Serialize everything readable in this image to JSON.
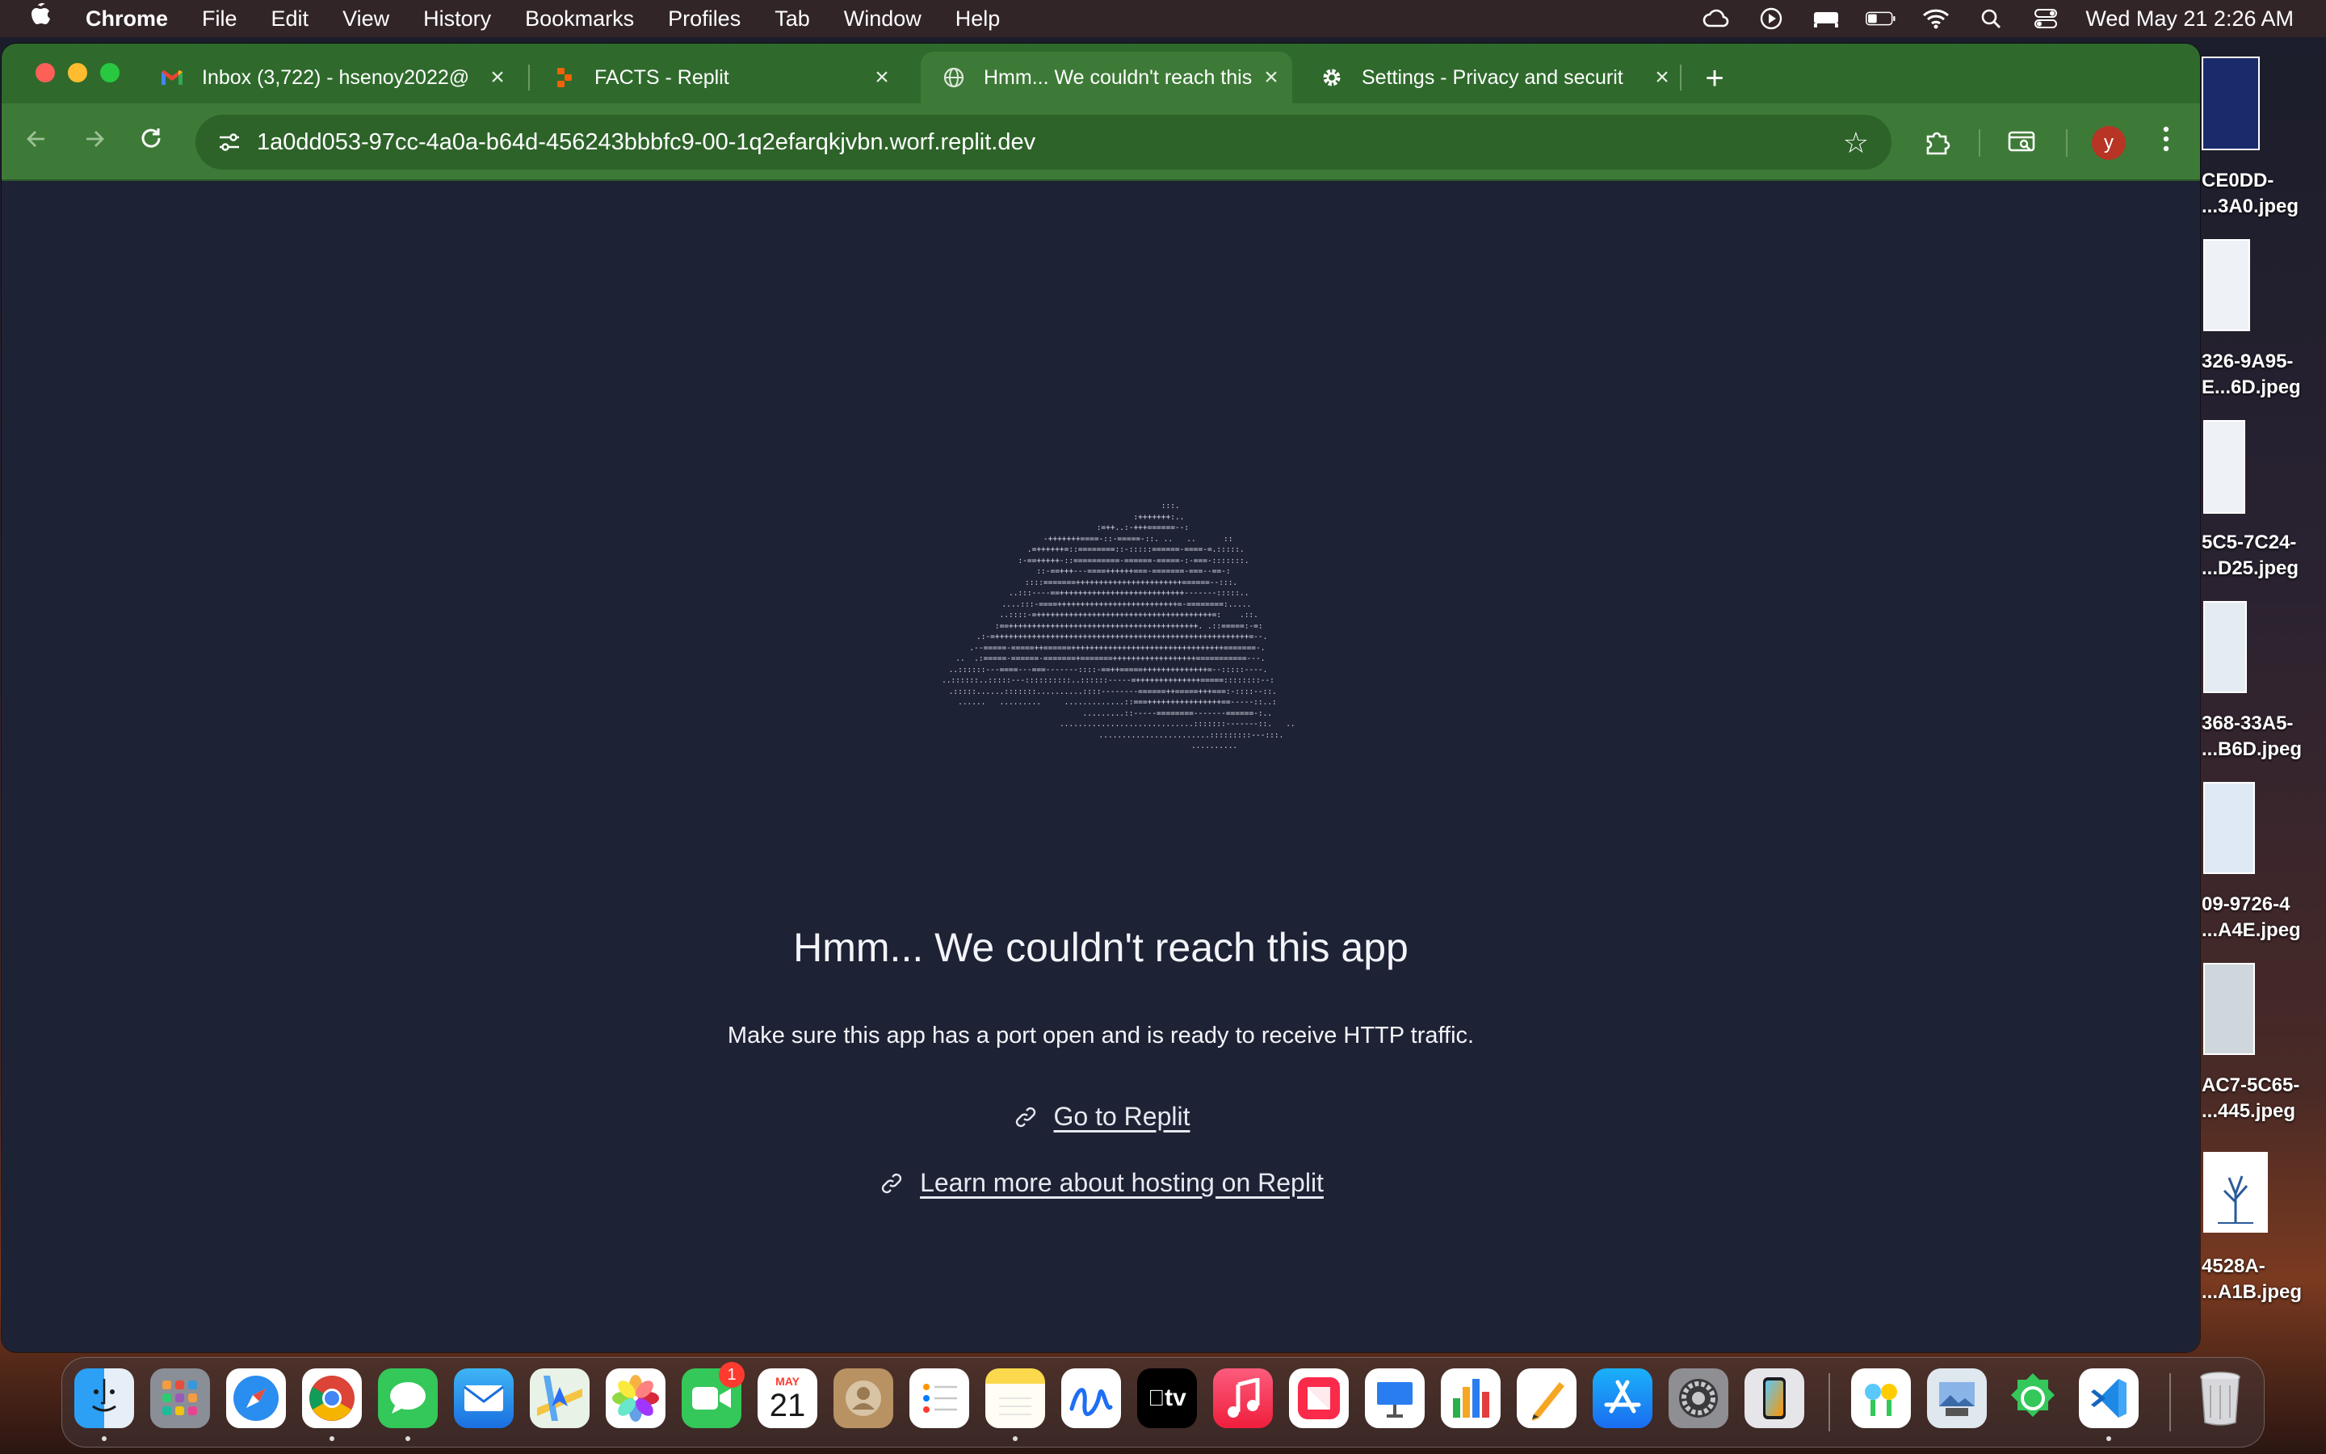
{
  "menubar": {
    "app_name": "Chrome",
    "items": [
      "File",
      "Edit",
      "View",
      "History",
      "Bookmarks",
      "Profiles",
      "Tab",
      "Window",
      "Help"
    ],
    "clock": "Wed May 21  2:26 AM"
  },
  "tabs": [
    {
      "title": "Inbox (3,722) - hsenoy2022@",
      "icon": "gmail-icon",
      "active": false
    },
    {
      "title": "FACTS - Replit",
      "icon": "replit-icon",
      "active": false
    },
    {
      "title": "Hmm... We couldn't reach this",
      "icon": "globe-icon",
      "active": true
    },
    {
      "title": "Settings - Privacy and securit",
      "icon": "gear-icon",
      "active": false
    }
  ],
  "address_bar": {
    "url": "1a0dd053-97cc-4a0a-b64d-456243bbbfc9-00-1q2efarqkjvbn.worf.replit.dev"
  },
  "profile_initial": "y",
  "page": {
    "title": "Hmm... We couldn't reach this app",
    "subtitle": "Make sure this app has a port open and is ready to receive HTTP traffic.",
    "link_replit": "Go to Replit",
    "link_hosting": "Learn more about hosting on Replit"
  },
  "desktop_files": [
    {
      "label_line1": "CE0DD-",
      "label_line2": "...3A0.jpeg"
    },
    {
      "label_line1": "326-9A95-",
      "label_line2": "E...6D.jpeg"
    },
    {
      "label_line1": "5C5-7C24-",
      "label_line2": "...D25.jpeg"
    },
    {
      "label_line1": "368-33A5-",
      "label_line2": "...B6D.jpeg"
    },
    {
      "label_line1": "09-9726-4",
      "label_line2": "...A4E.jpeg"
    },
    {
      "label_line1": "AC7-5C65-",
      "label_line2": "...445.jpeg"
    },
    {
      "label_line1": "4528A-",
      "label_line2": "...A1B.jpeg"
    }
  ],
  "dock": {
    "calendar_month": "MAY",
    "calendar_day": "21",
    "facetime_badge": "1",
    "tv_label": "tv"
  },
  "colors": {
    "tab_strip": "#2f6a2c",
    "toolbar": "#3d7a37",
    "page_background": "#1e2235",
    "avatar": "#b83424"
  }
}
